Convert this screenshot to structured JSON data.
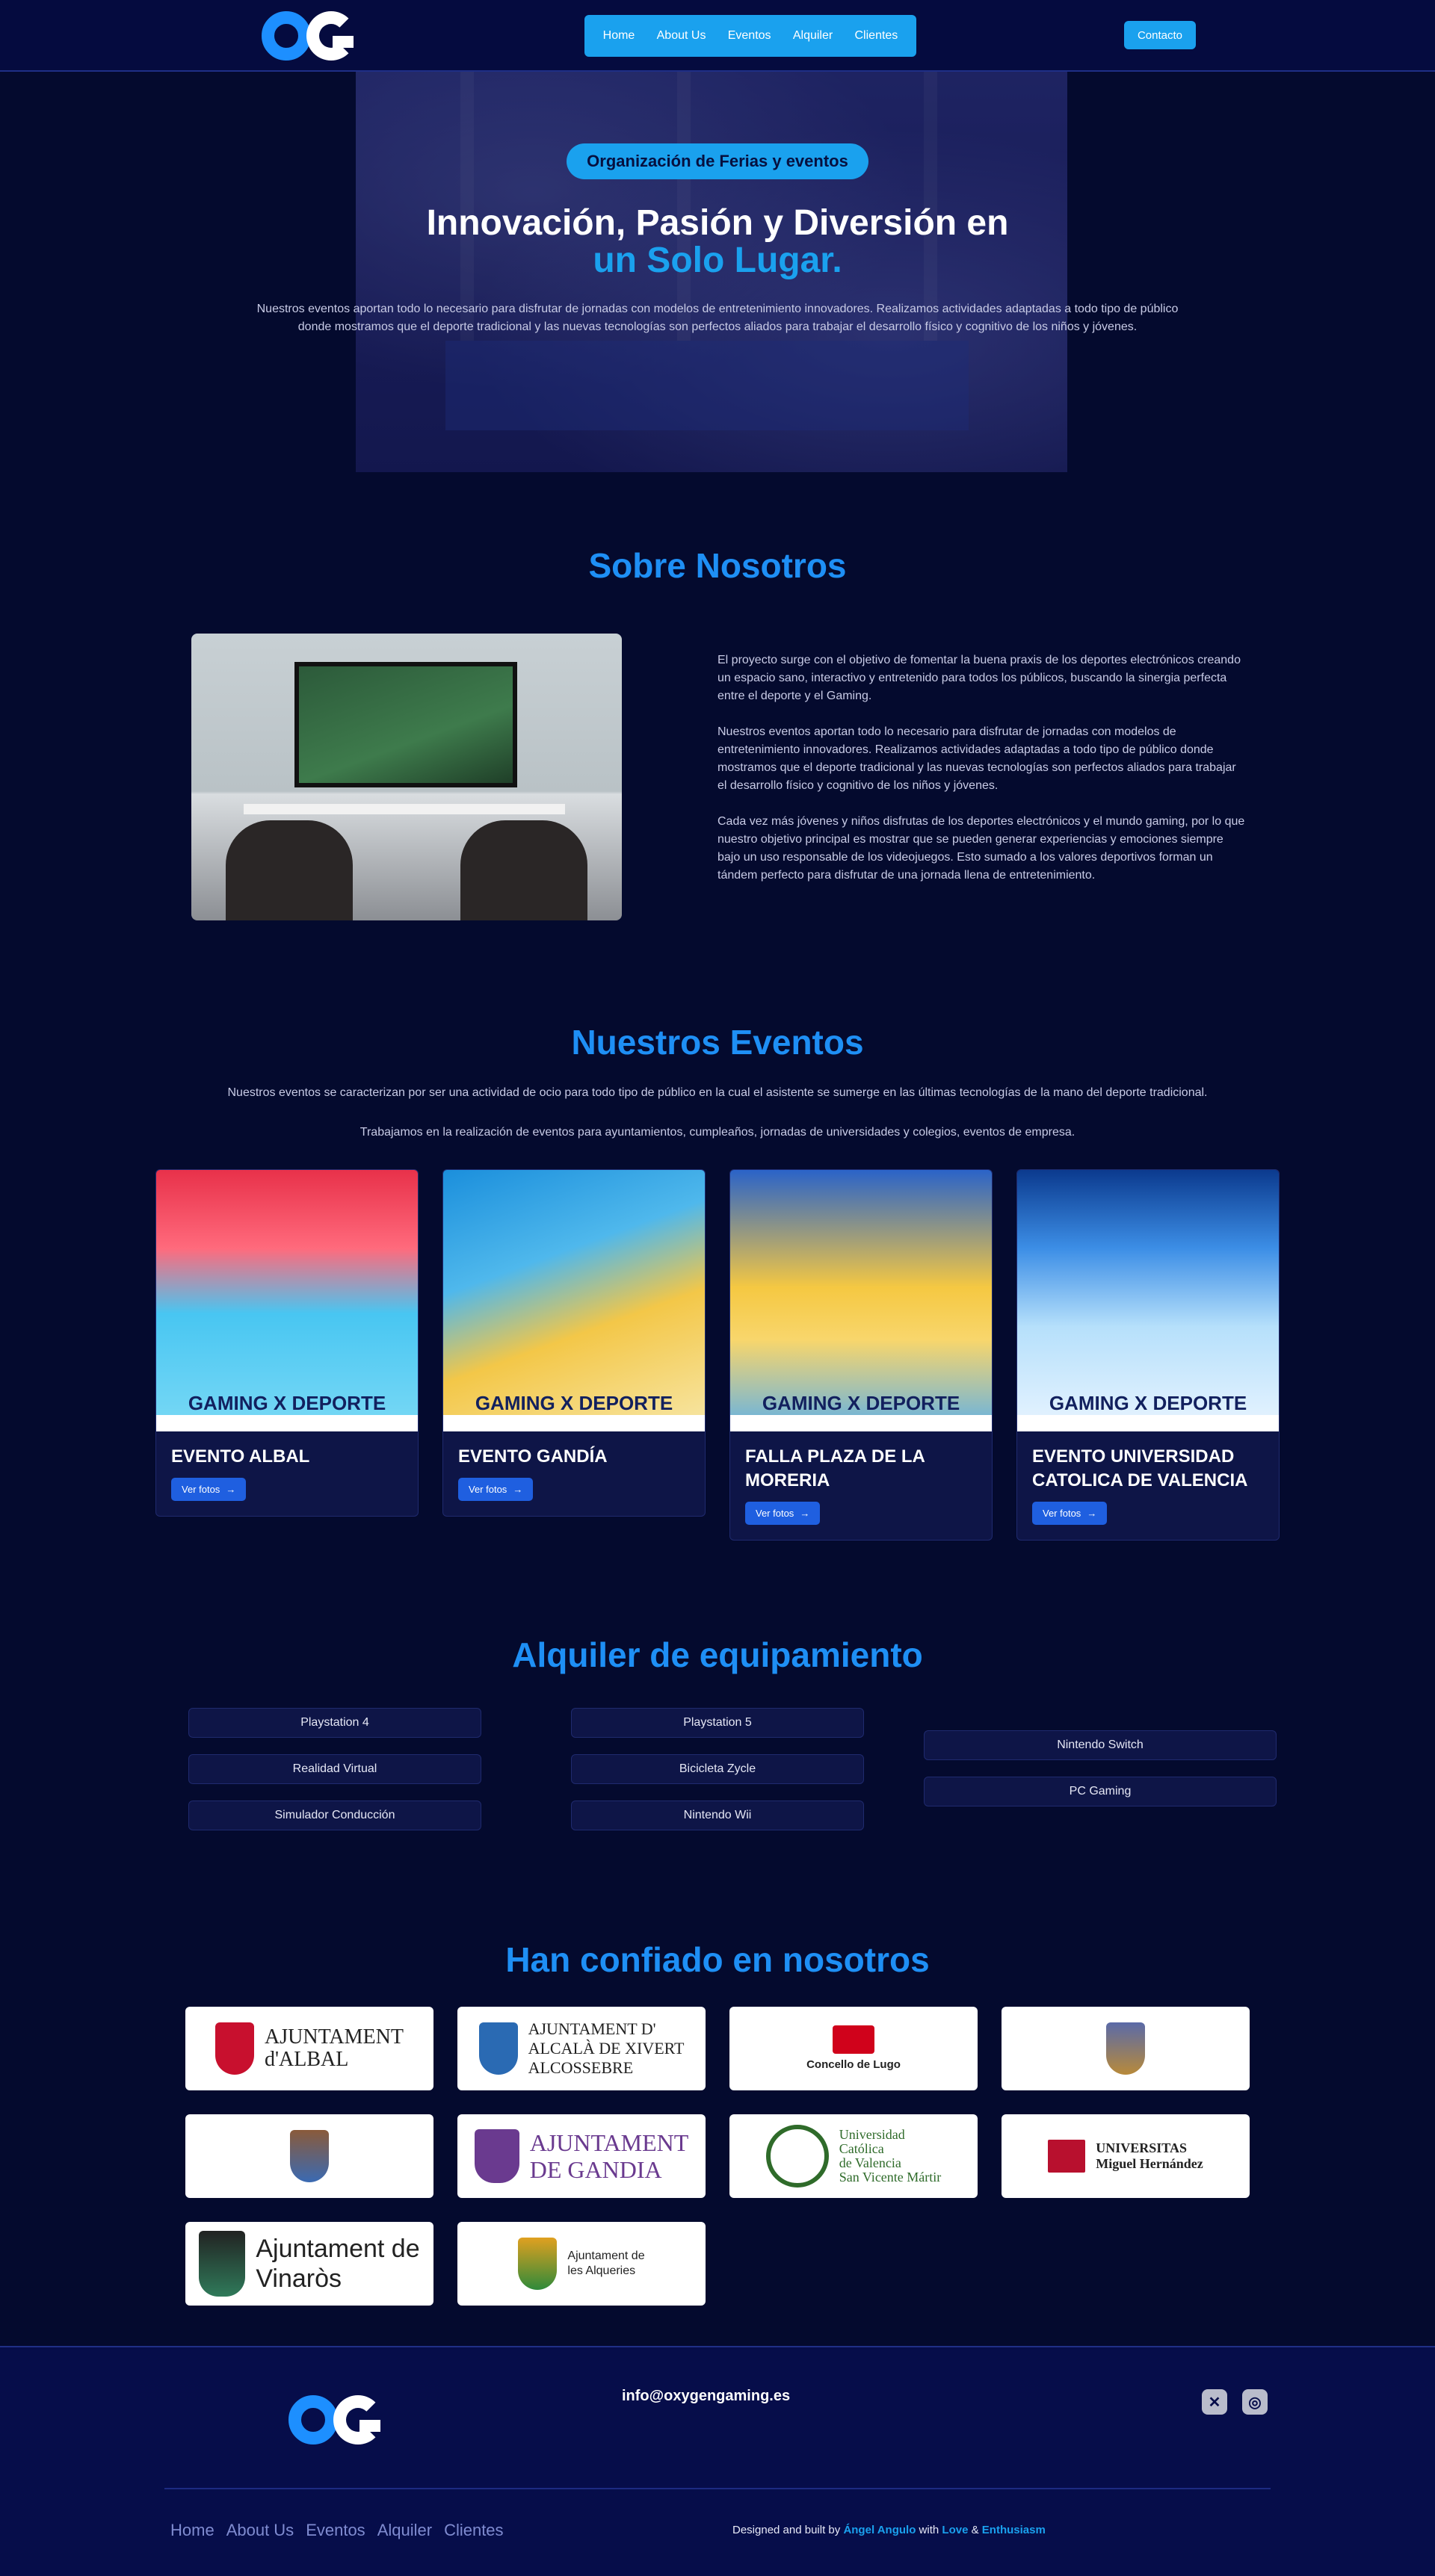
{
  "nav": {
    "links": [
      "Home",
      "About Us",
      "Eventos",
      "Alquiler",
      "Clientes"
    ],
    "contact_label": "Contacto"
  },
  "hero": {
    "badge": "Organización de Ferias y eventos",
    "title_line1": "Innovación, Pasión y Diversión en",
    "title_line2": "un Solo Lugar.",
    "text": "Nuestros eventos aportan todo lo necesario para disfrutar de jornadas con modelos de entretenimiento innovadores. Realizamos actividades adaptadas a todo tipo de público donde mostramos que el deporte tradicional y las nuevas tecnologías son perfectos aliados para trabajar el desarrollo físico y cognitivo de los niños y jóvenes."
  },
  "about": {
    "title": "Sobre Nosotros",
    "paragraphs": [
      "El proyecto surge con el objetivo de fomentar la buena praxis de los deportes electrónicos creando un espacio sano, interactivo y entretenido para todos los públicos, buscando la sinergia perfecta entre el deporte y el Gaming.",
      "Nuestros eventos aportan todo lo necesario para disfrutar de jornadas con modelos de entretenimiento innovadores. Realizamos actividades adaptadas a todo tipo de público donde mostramos que el deporte tradicional y las nuevas tecnologías son perfectos aliados para trabajar el desarrollo físico y cognitivo de los niños y jóvenes.",
      "Cada vez más jóvenes y niños disfrutas de los deportes electrónicos y el mundo gaming, por lo que nuestro objetivo principal es mostrar que se pueden generar experiencias y emociones siempre bajo un uso responsable de los videojuegos. Esto sumado a los valores deportivos forman un tándem perfecto para disfrutar de una jornada llena de entretenimiento."
    ]
  },
  "events": {
    "title": "Nuestros Eventos",
    "intro1": "Nuestros eventos se caracterizan por ser una actividad de ocio para todo tipo de público en la cual el asistente se sumerge en las últimas tecnologías de la mano del deporte tradicional.",
    "intro2": "Trabajamos en la realización de eventos para ayuntamientos, cumpleaños, jornadas de universidades y colegios, eventos de empresa.",
    "button_label": "Ver fotos",
    "poster_title": "GAMING X DEPORTE",
    "cards": [
      {
        "name": "EVENTO ALBAL"
      },
      {
        "name": "EVENTO GANDÍA"
      },
      {
        "name": "FALLA PLAZA DE LA MORERIA"
      },
      {
        "name": "EVENTO UNIVERSIDAD CATOLICA DE VALENCIA"
      }
    ]
  },
  "rental": {
    "title": "Alquiler de equipamiento",
    "col1": [
      "Playstation 4",
      "Realidad Virtual",
      "Simulador Conducción"
    ],
    "col2": [
      "Playstation 5",
      "Bicicleta Zycle",
      "Nintendo Wii"
    ],
    "col3": [
      "Nintendo Switch",
      "PC Gaming"
    ]
  },
  "clients": {
    "title": "Han confiado en nosotros",
    "logos": [
      {
        "text": "AJUNTAMENT\nd'ALBAL",
        "color": "#c8102e"
      },
      {
        "text": "AJUNTAMENT D'\nALCALÀ DE XIVERT\nALCOSSEBRE",
        "color": "#2a6ab3"
      },
      {
        "text": "Concello de Lugo",
        "color": "#d0021b"
      },
      {
        "text": "",
        "color": "#7a6a2a"
      },
      {
        "text": "",
        "color": "#8a5a3a"
      },
      {
        "text": "AJUNTAMENT\nDE GANDIA",
        "color": "#6a3a8f"
      },
      {
        "text": "Universidad\nCatólica\nde Valencia\nSan Vicente Mártir",
        "color": "#2f6b2a"
      },
      {
        "text": "UNIVERSITAS\nMiguel Hernández",
        "color": "#b8102e"
      },
      {
        "text": "Ajuntament de\nVinaròs",
        "color": "#222222"
      },
      {
        "text": "Ajuntament de\nles Alqueries",
        "color": "#e0a020"
      }
    ]
  },
  "footer": {
    "email": "info@oxygengaming.es",
    "links": [
      "Home",
      "About Us",
      "Eventos",
      "Alquiler",
      "Clientes"
    ],
    "credit_prefix": "Designed and built by",
    "credit_author": "Ángel Angulo",
    "credit_with": "with",
    "credit_love": "Love",
    "credit_amp": "&",
    "credit_enthusiasm": "Enthusiasm",
    "social": [
      "x-icon",
      "instagram-icon"
    ]
  }
}
